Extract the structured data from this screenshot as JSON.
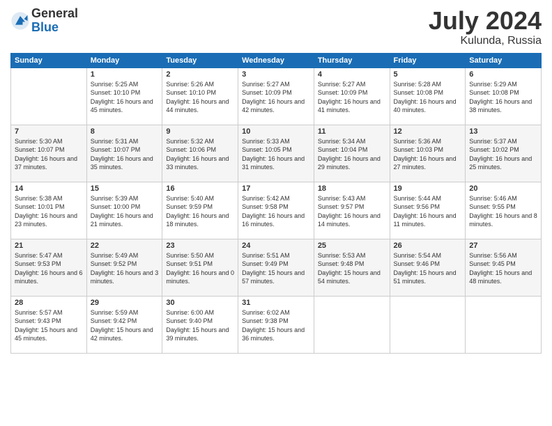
{
  "header": {
    "logo": {
      "general": "General",
      "blue": "Blue"
    },
    "title": "July 2024",
    "location": "Kulunda, Russia"
  },
  "columns": [
    "Sunday",
    "Monday",
    "Tuesday",
    "Wednesday",
    "Thursday",
    "Friday",
    "Saturday"
  ],
  "weeks": [
    [
      {
        "day": "",
        "data": ""
      },
      {
        "day": "1",
        "data": "Sunrise: 5:25 AM\nSunset: 10:10 PM\nDaylight: 16 hours and 45 minutes."
      },
      {
        "day": "2",
        "data": "Sunrise: 5:26 AM\nSunset: 10:10 PM\nDaylight: 16 hours and 44 minutes."
      },
      {
        "day": "3",
        "data": "Sunrise: 5:27 AM\nSunset: 10:09 PM\nDaylight: 16 hours and 42 minutes."
      },
      {
        "day": "4",
        "data": "Sunrise: 5:27 AM\nSunset: 10:09 PM\nDaylight: 16 hours and 41 minutes."
      },
      {
        "day": "5",
        "data": "Sunrise: 5:28 AM\nSunset: 10:08 PM\nDaylight: 16 hours and 40 minutes."
      },
      {
        "day": "6",
        "data": "Sunrise: 5:29 AM\nSunset: 10:08 PM\nDaylight: 16 hours and 38 minutes."
      }
    ],
    [
      {
        "day": "7",
        "data": "Sunrise: 5:30 AM\nSunset: 10:07 PM\nDaylight: 16 hours and 37 minutes."
      },
      {
        "day": "8",
        "data": "Sunrise: 5:31 AM\nSunset: 10:07 PM\nDaylight: 16 hours and 35 minutes."
      },
      {
        "day": "9",
        "data": "Sunrise: 5:32 AM\nSunset: 10:06 PM\nDaylight: 16 hours and 33 minutes."
      },
      {
        "day": "10",
        "data": "Sunrise: 5:33 AM\nSunset: 10:05 PM\nDaylight: 16 hours and 31 minutes."
      },
      {
        "day": "11",
        "data": "Sunrise: 5:34 AM\nSunset: 10:04 PM\nDaylight: 16 hours and 29 minutes."
      },
      {
        "day": "12",
        "data": "Sunrise: 5:36 AM\nSunset: 10:03 PM\nDaylight: 16 hours and 27 minutes."
      },
      {
        "day": "13",
        "data": "Sunrise: 5:37 AM\nSunset: 10:02 PM\nDaylight: 16 hours and 25 minutes."
      }
    ],
    [
      {
        "day": "14",
        "data": "Sunrise: 5:38 AM\nSunset: 10:01 PM\nDaylight: 16 hours and 23 minutes."
      },
      {
        "day": "15",
        "data": "Sunrise: 5:39 AM\nSunset: 10:00 PM\nDaylight: 16 hours and 21 minutes."
      },
      {
        "day": "16",
        "data": "Sunrise: 5:40 AM\nSunset: 9:59 PM\nDaylight: 16 hours and 18 minutes."
      },
      {
        "day": "17",
        "data": "Sunrise: 5:42 AM\nSunset: 9:58 PM\nDaylight: 16 hours and 16 minutes."
      },
      {
        "day": "18",
        "data": "Sunrise: 5:43 AM\nSunset: 9:57 PM\nDaylight: 16 hours and 14 minutes."
      },
      {
        "day": "19",
        "data": "Sunrise: 5:44 AM\nSunset: 9:56 PM\nDaylight: 16 hours and 11 minutes."
      },
      {
        "day": "20",
        "data": "Sunrise: 5:46 AM\nSunset: 9:55 PM\nDaylight: 16 hours and 8 minutes."
      }
    ],
    [
      {
        "day": "21",
        "data": "Sunrise: 5:47 AM\nSunset: 9:53 PM\nDaylight: 16 hours and 6 minutes."
      },
      {
        "day": "22",
        "data": "Sunrise: 5:49 AM\nSunset: 9:52 PM\nDaylight: 16 hours and 3 minutes."
      },
      {
        "day": "23",
        "data": "Sunrise: 5:50 AM\nSunset: 9:51 PM\nDaylight: 16 hours and 0 minutes."
      },
      {
        "day": "24",
        "data": "Sunrise: 5:51 AM\nSunset: 9:49 PM\nDaylight: 15 hours and 57 minutes."
      },
      {
        "day": "25",
        "data": "Sunrise: 5:53 AM\nSunset: 9:48 PM\nDaylight: 15 hours and 54 minutes."
      },
      {
        "day": "26",
        "data": "Sunrise: 5:54 AM\nSunset: 9:46 PM\nDaylight: 15 hours and 51 minutes."
      },
      {
        "day": "27",
        "data": "Sunrise: 5:56 AM\nSunset: 9:45 PM\nDaylight: 15 hours and 48 minutes."
      }
    ],
    [
      {
        "day": "28",
        "data": "Sunrise: 5:57 AM\nSunset: 9:43 PM\nDaylight: 15 hours and 45 minutes."
      },
      {
        "day": "29",
        "data": "Sunrise: 5:59 AM\nSunset: 9:42 PM\nDaylight: 15 hours and 42 minutes."
      },
      {
        "day": "30",
        "data": "Sunrise: 6:00 AM\nSunset: 9:40 PM\nDaylight: 15 hours and 39 minutes."
      },
      {
        "day": "31",
        "data": "Sunrise: 6:02 AM\nSunset: 9:38 PM\nDaylight: 15 hours and 36 minutes."
      },
      {
        "day": "",
        "data": ""
      },
      {
        "day": "",
        "data": ""
      },
      {
        "day": "",
        "data": ""
      }
    ]
  ]
}
